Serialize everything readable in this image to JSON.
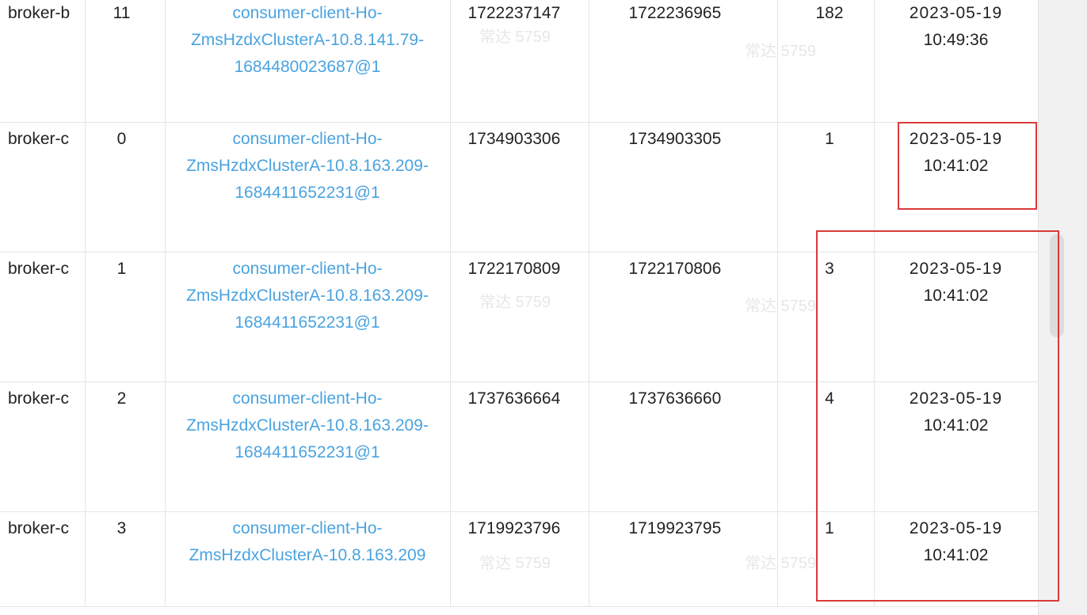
{
  "rows": [
    {
      "broker": "broker-b",
      "queue": "11",
      "client": "consumer-client-Ho-ZmsHzdxClusterA-10.8.141.79-1684480023687@1",
      "broker_offset": "1722237147",
      "consumer_offset": "1722236965",
      "diff": "182",
      "date": "2023-05-19",
      "time": "10:49:36"
    },
    {
      "broker": "broker-c",
      "queue": "0",
      "client": "consumer-client-Ho-ZmsHzdxClusterA-10.8.163.209-1684411652231@1",
      "broker_offset": "1734903306",
      "consumer_offset": "1734903305",
      "diff": "1",
      "date": "2023-05-19",
      "time": "10:41:02"
    },
    {
      "broker": "broker-c",
      "queue": "1",
      "client": "consumer-client-Ho-ZmsHzdxClusterA-10.8.163.209-1684411652231@1",
      "broker_offset": "1722170809",
      "consumer_offset": "1722170806",
      "diff": "3",
      "date": "2023-05-19",
      "time": "10:41:02"
    },
    {
      "broker": "broker-c",
      "queue": "2",
      "client": "consumer-client-Ho-ZmsHzdxClusterA-10.8.163.209-1684411652231@1",
      "broker_offset": "1737636664",
      "consumer_offset": "1737636660",
      "diff": "4",
      "date": "2023-05-19",
      "time": "10:41:02"
    },
    {
      "broker": "broker-c",
      "queue": "3",
      "client": "consumer-client-Ho-ZmsHzdxClusterA-10.8.163.209",
      "broker_offset": "1719923796",
      "consumer_offset": "1719923795",
      "diff": "1",
      "date": "2023-05-19",
      "time": "10:41:02"
    }
  ],
  "watermark": "常达 5759",
  "highlight_color": "#d93a3a"
}
